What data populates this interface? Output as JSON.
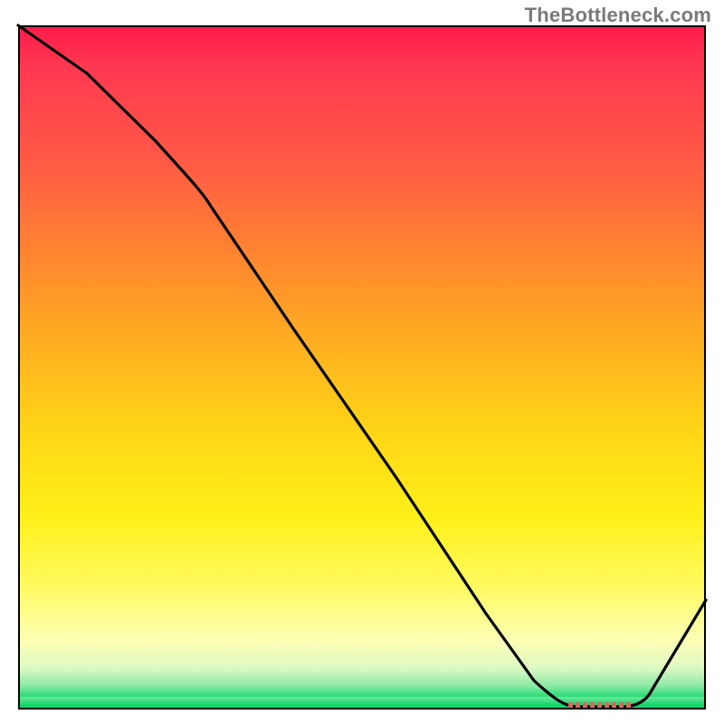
{
  "watermark": "TheBottleneck.com",
  "chart_data": {
    "type": "line",
    "title": "",
    "xlabel": "",
    "ylabel": "",
    "xlim": [
      0,
      100
    ],
    "ylim": [
      0,
      100
    ],
    "series": [
      {
        "name": "curve",
        "x": [
          0,
          10,
          20,
          28,
          40,
          55,
          68,
          75,
          80,
          85,
          88,
          92,
          100
        ],
        "values": [
          100,
          93,
          83,
          76,
          56,
          34,
          14,
          4,
          1,
          0,
          0,
          4,
          16
        ]
      }
    ],
    "minimum_band": {
      "x_start": 80,
      "x_end": 88,
      "color": "#d66a5e"
    },
    "background_gradient": {
      "top": "#ff1a4b",
      "mid": "#ffd716",
      "bottom": "#19d66f"
    }
  }
}
